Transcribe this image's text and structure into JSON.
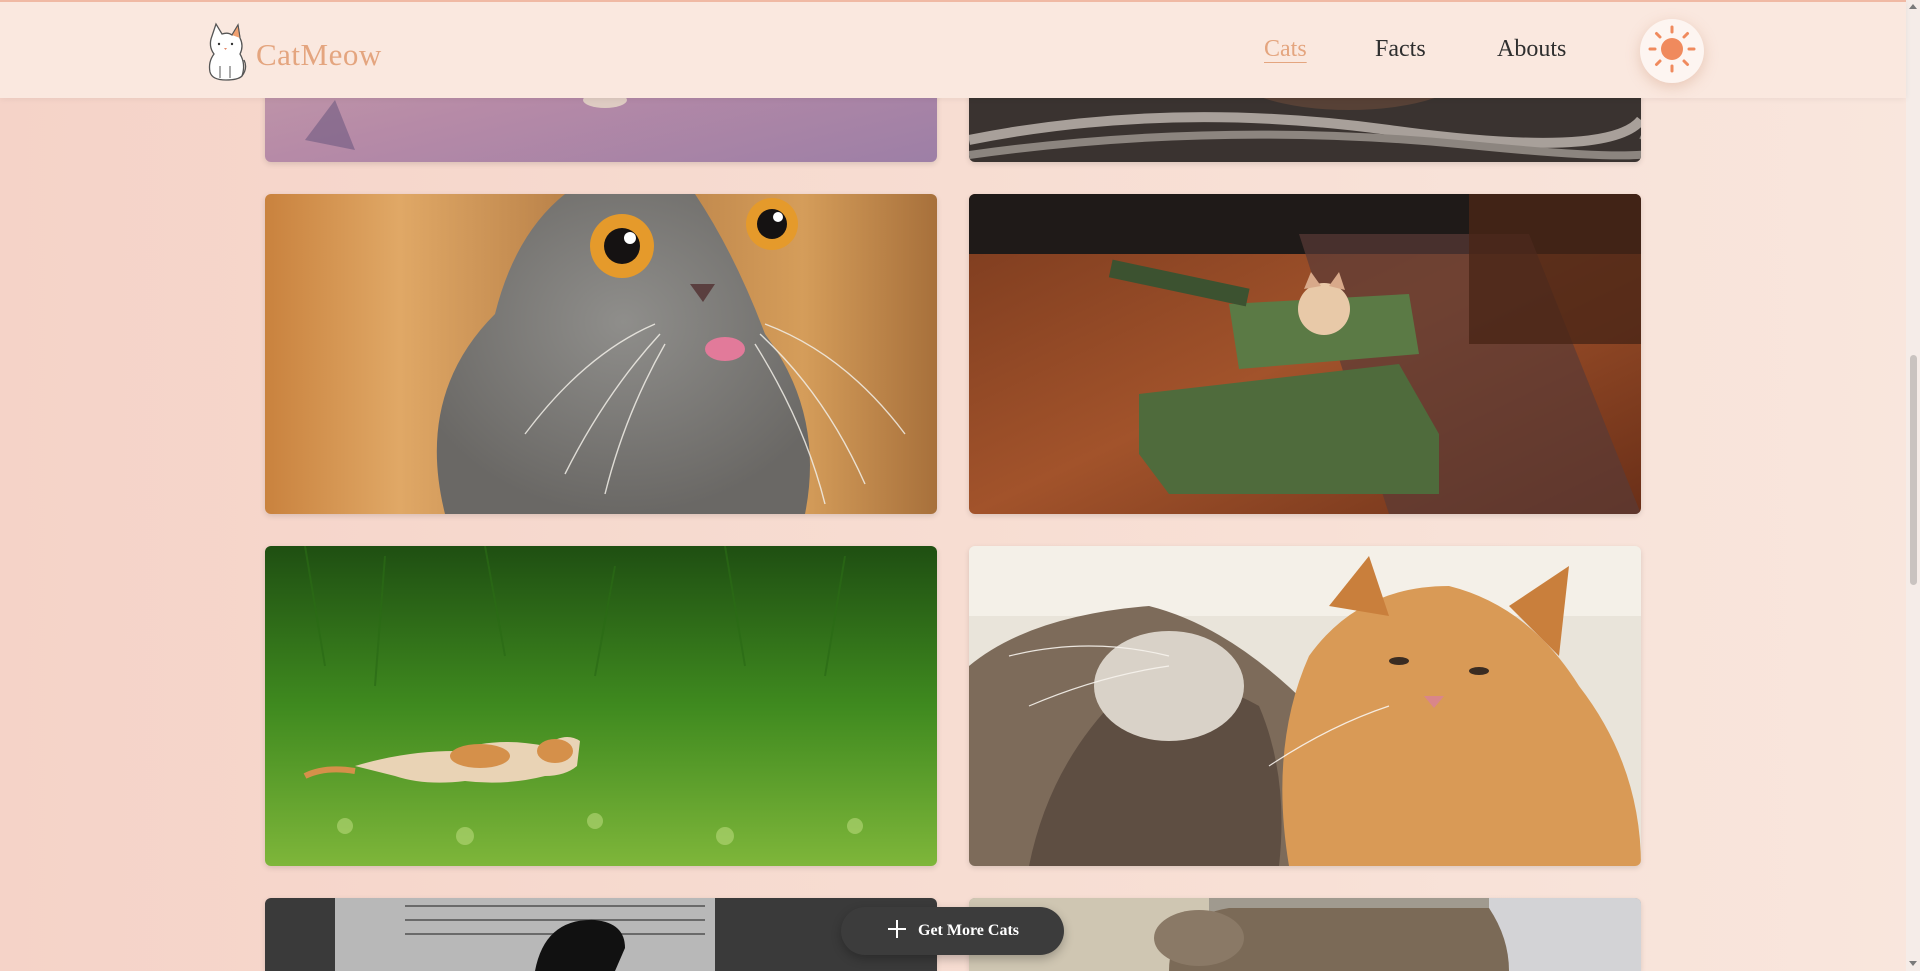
{
  "brand": {
    "name": "CatMeow",
    "logo_icon": "cat-logo-icon"
  },
  "nav": {
    "items": [
      {
        "label": "Cats",
        "active": true
      },
      {
        "label": "Facts",
        "active": false
      },
      {
        "label": "Abouts",
        "active": false
      }
    ],
    "theme_toggle_icon": "sun-icon"
  },
  "gallery": {
    "images": [
      {
        "id": "cat-photo-1",
        "desc": "cat on a pink-purple floor (top cropped)"
      },
      {
        "id": "cat-photo-2",
        "desc": "cat with wires (top cropped)"
      },
      {
        "id": "cat-photo-3",
        "desc": "grey kitten with tongue out"
      },
      {
        "id": "cat-photo-4",
        "desc": "kitten inside a cardboard tank"
      },
      {
        "id": "cat-photo-5",
        "desc": "orange and white cat walking in grass"
      },
      {
        "id": "cat-photo-6",
        "desc": "tabby and orange kitten cuddling"
      },
      {
        "id": "cat-photo-7",
        "desc": "black cat near a window (bottom cropped)"
      },
      {
        "id": "cat-photo-8",
        "desc": "tabby cat walking (bottom cropped)"
      }
    ]
  },
  "actions": {
    "get_more_label": "Get More Cats",
    "get_more_icon": "plus-icon"
  },
  "colors": {
    "accent": "#e4a57f",
    "nav_bg": "#fae8df",
    "button_bg": "#3c3c3c",
    "sun": "#f08a5d"
  }
}
